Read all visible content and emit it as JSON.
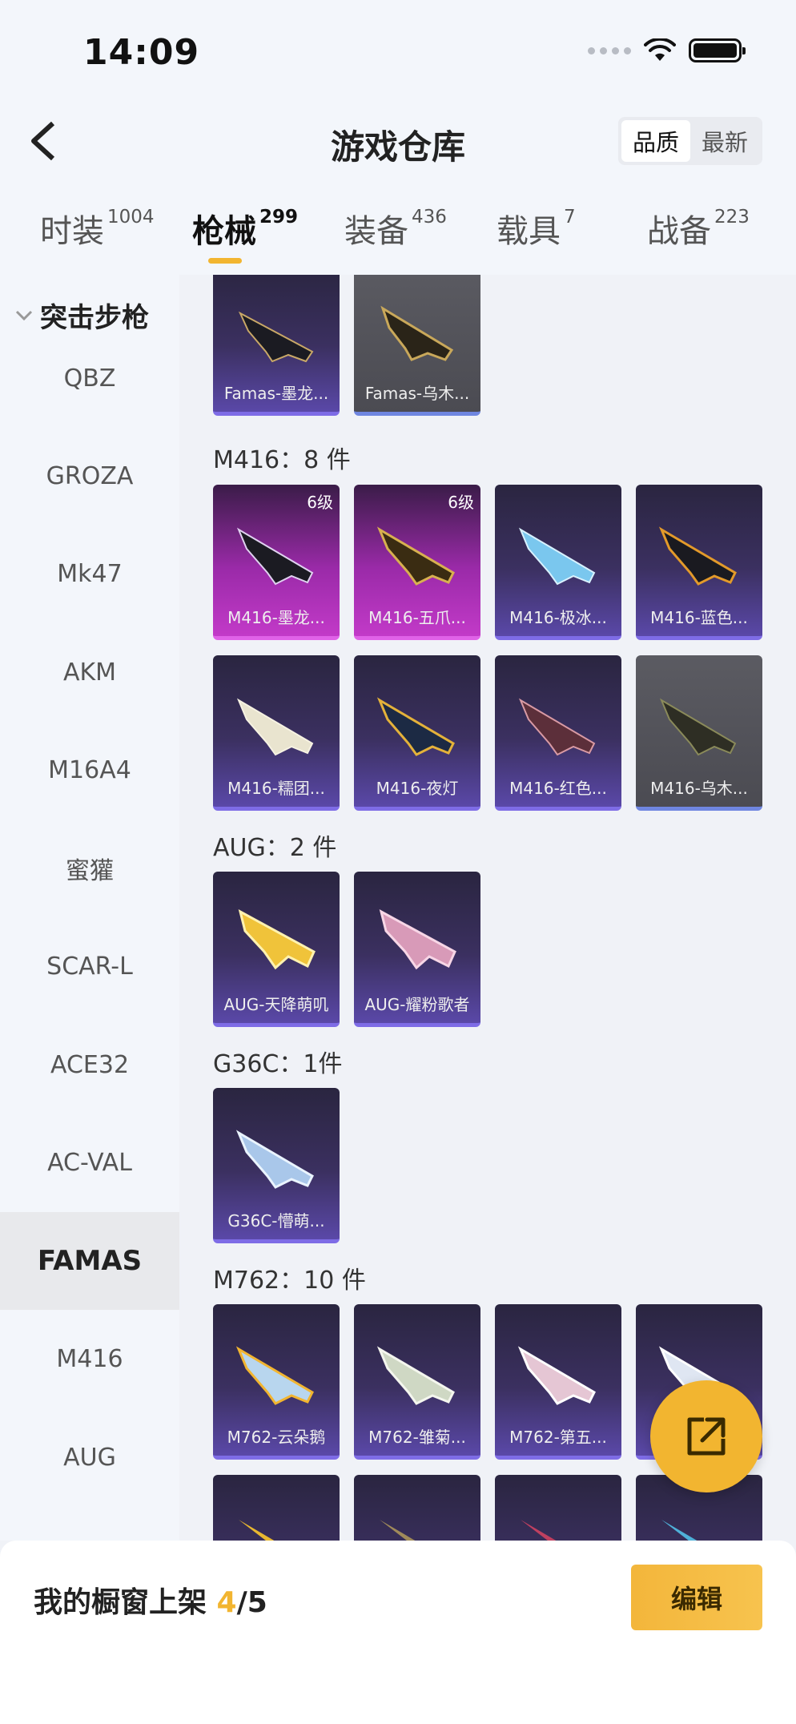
{
  "status_bar": {
    "time": "14:09"
  },
  "header": {
    "title": "游戏仓库",
    "sort_options": [
      "品质",
      "最新"
    ],
    "active_sort": "品质"
  },
  "tabs": [
    {
      "label": "时装",
      "count": "1004"
    },
    {
      "label": "枪械",
      "count": "299"
    },
    {
      "label": "装备",
      "count": "436"
    },
    {
      "label": "载具",
      "count": "7"
    },
    {
      "label": "战备",
      "count": "223"
    }
  ],
  "sidebar": {
    "group": "突击步枪",
    "items": [
      "QBZ",
      "GROZA",
      "Mk47",
      "AKM",
      "M16A4",
      "蜜獾",
      "SCAR-L",
      "ACE32",
      "AC-VAL",
      "FAMAS",
      "M416",
      "AUG"
    ],
    "active": "FAMAS"
  },
  "sections": {
    "famas_cards": [
      "Famas-墨龙...",
      "Famas-乌木..."
    ],
    "m416_title": "M416：8 件",
    "m416_cards": [
      "M416-墨龙...",
      "M416-五爪...",
      "M416-极冰...",
      "M416-蓝色...",
      "M416-糯团...",
      "M416-夜灯",
      "M416-红色...",
      "M416-乌木..."
    ],
    "m416_levels": [
      "6级",
      "6级"
    ],
    "aug_title": "AUG：2 件",
    "aug_cards": [
      "AUG-天降萌叽",
      "AUG-耀粉歌者"
    ],
    "g36c_title": "G36C：1件",
    "g36c_cards": [
      "G36C-懵萌..."
    ],
    "m762_title": "M762：10 件",
    "m762_cards": [
      "M762-云朵鹅",
      "M762-雏菊...",
      "M762-第五...",
      ""
    ]
  },
  "bottom": {
    "shelf_label": "我的橱窗上架 ",
    "shelf_count": "4",
    "shelf_total": "/5",
    "edit_label": "编辑"
  },
  "colors": {
    "accent": "#f2b530",
    "card_purple": "#5a48a8",
    "card_pink": "#c23ac8"
  }
}
